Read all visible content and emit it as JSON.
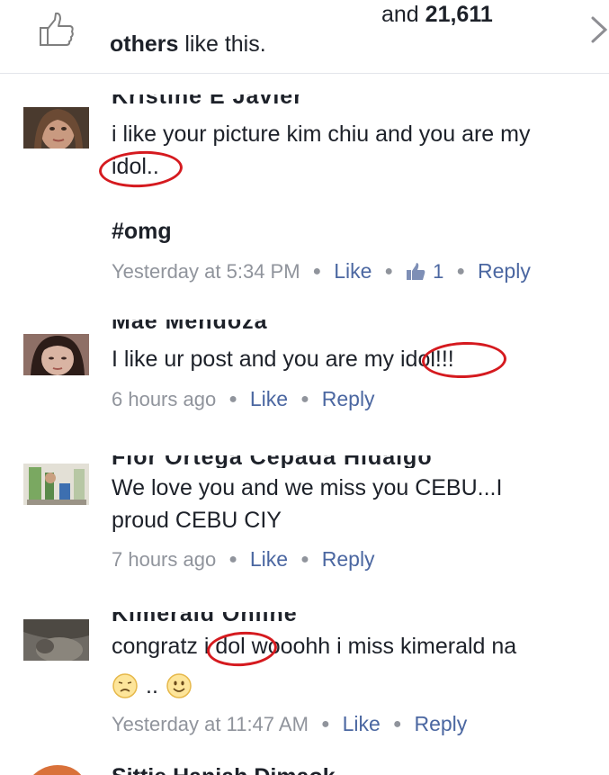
{
  "header": {
    "count_prefix": "and",
    "count": "21,611",
    "others": "others",
    "suffix": "like this."
  },
  "comments": [
    {
      "name": "Kristine E Javier",
      "text_a": "i like your picture kim chiu and you are my",
      "text_b": "idol..",
      "hashtag": "#omg",
      "time": "Yesterday at 5:34 PM",
      "like": "Like",
      "likes_count": "1",
      "reply": "Reply"
    },
    {
      "name": "Mae Mendoza",
      "text": "I like ur post and you are my idol!!!",
      "time": "6 hours ago",
      "like": "Like",
      "reply": "Reply"
    },
    {
      "name": "Flor Ortega Cepada Hidalgo",
      "text_a": "We love you and we miss you CEBU...I",
      "text_b": "proud CEBU CIY",
      "time": "7 hours ago",
      "like": "Like",
      "reply": "Reply"
    },
    {
      "name": "Kimerald Online",
      "text": "congratz i dol wooohh i miss kimerald na",
      "emoji_sep": "..",
      "time": "Yesterday at 11:47 AM",
      "like": "Like",
      "reply": "Reply"
    }
  ],
  "next_comment": {
    "name": "Sittie Haniah Dimaok"
  },
  "colors": {
    "link": "#4b67a1",
    "meta": "#90949c",
    "annotation": "#d51a1f"
  }
}
